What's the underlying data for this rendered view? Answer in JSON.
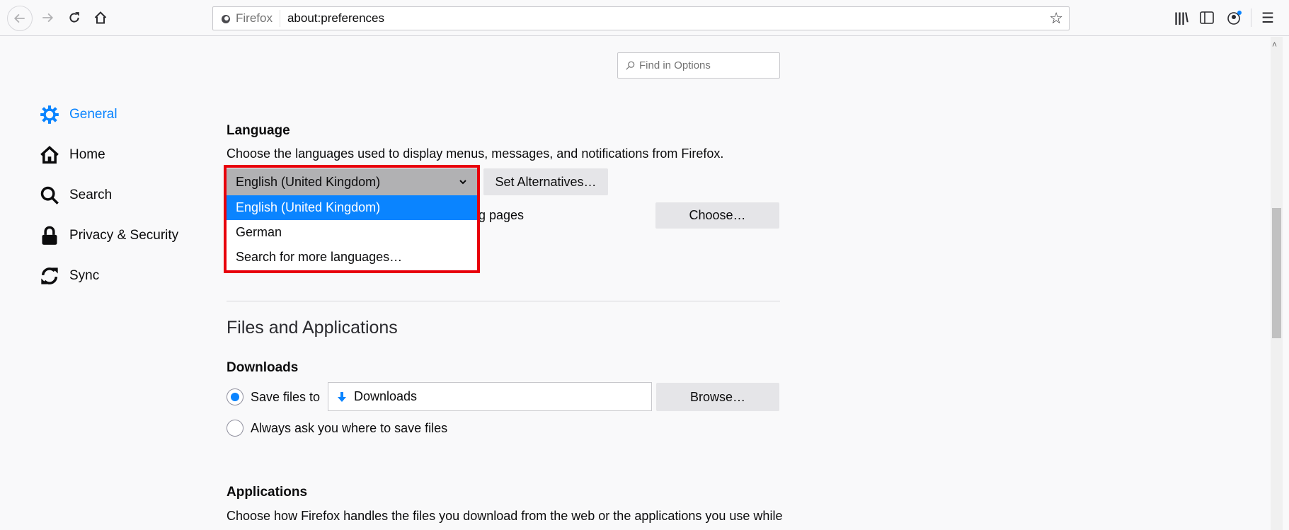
{
  "browser": {
    "identity_label": "Firefox",
    "url": "about:preferences"
  },
  "find": {
    "placeholder": "Find in Options"
  },
  "sidebar": {
    "items": [
      {
        "label": "General",
        "icon": "gear-icon",
        "active": true
      },
      {
        "label": "Home",
        "icon": "home-icon"
      },
      {
        "label": "Search",
        "icon": "search-icon"
      },
      {
        "label": "Privacy & Security",
        "icon": "lock-icon"
      },
      {
        "label": "Sync",
        "icon": "sync-icon"
      }
    ]
  },
  "language": {
    "heading": "Language",
    "description": "Choose the languages used to display menus, messages, and notifications from Firefox.",
    "selected": "English (United Kingdom)",
    "options": [
      "English (United Kingdom)",
      "German",
      "Search for more languages…"
    ],
    "set_alternatives": "Set Alternatives…",
    "pages_text_visible": "g pages",
    "choose": "Choose…"
  },
  "files": {
    "heading": "Files and Applications",
    "downloads_heading": "Downloads",
    "save_files_label": "Save files to",
    "download_folder": "Downloads",
    "browse": "Browse…",
    "always_ask_label": "Always ask you where to save files",
    "applications_heading": "Applications",
    "applications_description": "Choose how Firefox handles the files you download from the web or the applications you use while"
  },
  "colors": {
    "accent": "#0a84ff",
    "highlight_border": "#e8000b"
  }
}
